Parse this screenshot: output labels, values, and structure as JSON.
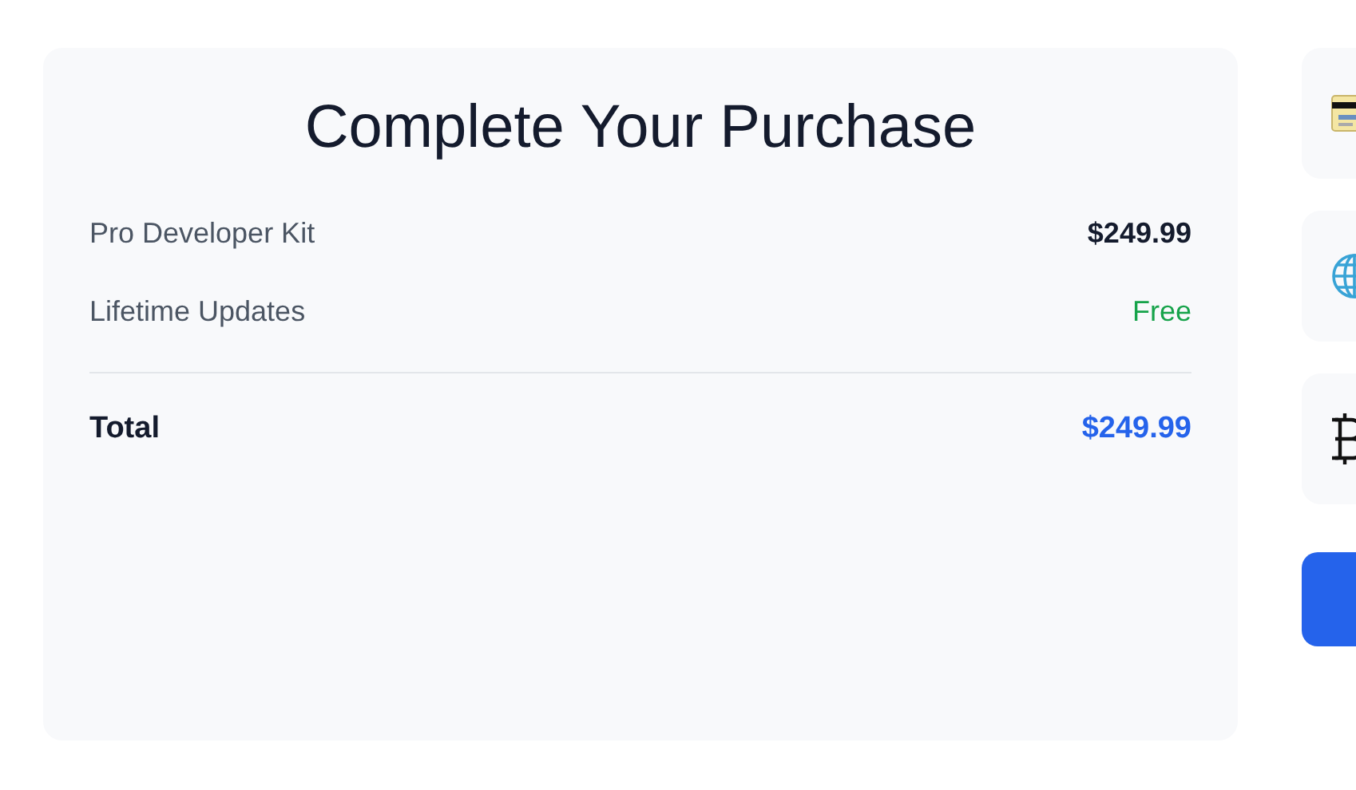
{
  "title": "Complete Your Purchase",
  "items": [
    {
      "label": "Pro Developer Kit",
      "value": "$249.99",
      "kind": "price"
    },
    {
      "label": "Lifetime Updates",
      "value": "Free",
      "kind": "free"
    }
  ],
  "total": {
    "label": "Total",
    "value": "$249.99"
  },
  "payment_options": [
    {
      "kind": "card"
    },
    {
      "kind": "globe"
    },
    {
      "kind": "crypto"
    }
  ],
  "pay_button": {
    "kind": "primary"
  }
}
